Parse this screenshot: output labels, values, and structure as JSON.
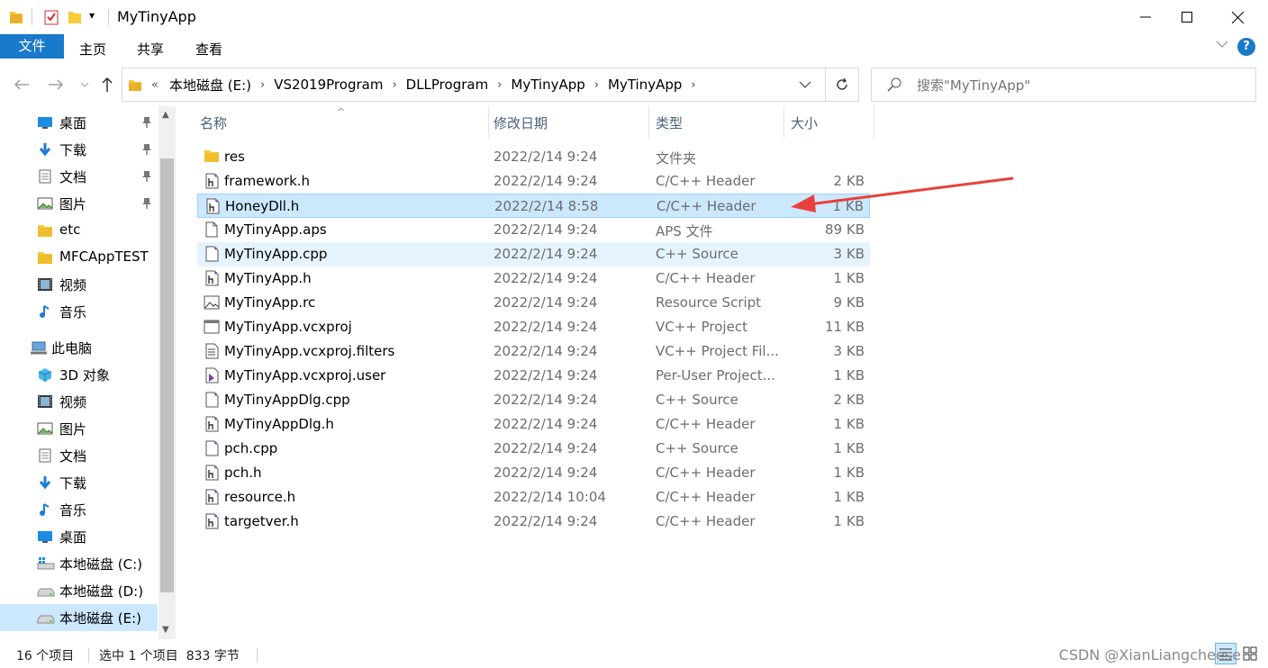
{
  "window": {
    "title": "MyTinyApp",
    "quick_access_dropdown": "▾"
  },
  "ribbon": {
    "tabs": [
      "文件",
      "主页",
      "共享",
      "查看"
    ],
    "help": "?"
  },
  "address": {
    "overflow": "«",
    "crumbs": [
      "本地磁盘 (E:)",
      "VS2019Program",
      "DLLProgram",
      "MyTinyApp",
      "MyTinyApp"
    ]
  },
  "search": {
    "placeholder": "搜索\"MyTinyApp\""
  },
  "sidebar": {
    "quick_access": [
      {
        "label": "桌面",
        "icon": "desktop-icon",
        "pinned": true
      },
      {
        "label": "下载",
        "icon": "download-icon",
        "pinned": true
      },
      {
        "label": "文档",
        "icon": "document-icon",
        "pinned": true
      },
      {
        "label": "图片",
        "icon": "picture-icon",
        "pinned": true
      },
      {
        "label": "etc",
        "icon": "folder-icon",
        "pinned": false
      },
      {
        "label": "MFCAppTEST",
        "icon": "folder-icon",
        "pinned": false
      },
      {
        "label": "视频",
        "icon": "video-icon",
        "pinned": false
      },
      {
        "label": "音乐",
        "icon": "music-icon",
        "pinned": false
      }
    ],
    "this_pc": {
      "label": "此电脑",
      "icon": "computer-icon"
    },
    "pc_items": [
      {
        "label": "3D 对象",
        "icon": "3d-objects-icon"
      },
      {
        "label": "视频",
        "icon": "video-icon"
      },
      {
        "label": "图片",
        "icon": "picture-icon"
      },
      {
        "label": "文档",
        "icon": "document-icon"
      },
      {
        "label": "下载",
        "icon": "download-icon"
      },
      {
        "label": "音乐",
        "icon": "music-icon"
      },
      {
        "label": "桌面",
        "icon": "desktop-icon"
      },
      {
        "label": "本地磁盘 (C:)",
        "icon": "system-drive-icon"
      },
      {
        "label": "本地磁盘 (D:)",
        "icon": "drive-icon"
      },
      {
        "label": "本地磁盘 (E:)",
        "icon": "drive-icon",
        "selected": true
      }
    ]
  },
  "columns": {
    "name": "名称",
    "date": "修改日期",
    "type": "类型",
    "size": "大小"
  },
  "files": [
    {
      "name": "res",
      "date": "2022/2/14 9:24",
      "type": "文件夹",
      "size": "",
      "icon": "folder-icon"
    },
    {
      "name": "framework.h",
      "date": "2022/2/14 9:24",
      "type": "C/C++ Header",
      "size": "2 KB",
      "icon": "header-file-icon"
    },
    {
      "name": "HoneyDll.h",
      "date": "2022/2/14 8:58",
      "type": "C/C++ Header",
      "size": "1 KB",
      "icon": "header-file-icon",
      "state": "selected"
    },
    {
      "name": "MyTinyApp.aps",
      "date": "2022/2/14 9:24",
      "type": "APS 文件",
      "size": "89 KB",
      "icon": "blank-file-icon"
    },
    {
      "name": "MyTinyApp.cpp",
      "date": "2022/2/14 9:24",
      "type": "C++ Source",
      "size": "3 KB",
      "icon": "cpp-file-icon",
      "state": "hover"
    },
    {
      "name": "MyTinyApp.h",
      "date": "2022/2/14 9:24",
      "type": "C/C++ Header",
      "size": "1 KB",
      "icon": "header-file-icon"
    },
    {
      "name": "MyTinyApp.rc",
      "date": "2022/2/14 9:24",
      "type": "Resource Script",
      "size": "9 KB",
      "icon": "resource-file-icon"
    },
    {
      "name": "MyTinyApp.vcxproj",
      "date": "2022/2/14 9:24",
      "type": "VC++ Project",
      "size": "11 KB",
      "icon": "project-file-icon"
    },
    {
      "name": "MyTinyApp.vcxproj.filters",
      "date": "2022/2/14 9:24",
      "type": "VC++ Project Fil...",
      "size": "3 KB",
      "icon": "filters-file-icon"
    },
    {
      "name": "MyTinyApp.vcxproj.user",
      "date": "2022/2/14 9:24",
      "type": "Per-User Project...",
      "size": "1 KB",
      "icon": "vs-user-file-icon"
    },
    {
      "name": "MyTinyAppDlg.cpp",
      "date": "2022/2/14 9:24",
      "type": "C++ Source",
      "size": "2 KB",
      "icon": "cpp-file-icon"
    },
    {
      "name": "MyTinyAppDlg.h",
      "date": "2022/2/14 9:24",
      "type": "C/C++ Header",
      "size": "1 KB",
      "icon": "header-file-icon"
    },
    {
      "name": "pch.cpp",
      "date": "2022/2/14 9:24",
      "type": "C++ Source",
      "size": "1 KB",
      "icon": "cpp-file-icon"
    },
    {
      "name": "pch.h",
      "date": "2022/2/14 9:24",
      "type": "C/C++ Header",
      "size": "1 KB",
      "icon": "header-file-icon"
    },
    {
      "name": "resource.h",
      "date": "2022/2/14 10:04",
      "type": "C/C++ Header",
      "size": "1 KB",
      "icon": "header-file-icon"
    },
    {
      "name": "targetver.h",
      "date": "2022/2/14 9:24",
      "type": "C/C++ Header",
      "size": "1 KB",
      "icon": "header-file-icon"
    }
  ],
  "status": {
    "count": "16 个项目",
    "selection": "选中 1 个项目  833 字节",
    "watermark": "CSDN @XianLiangcheese"
  },
  "colors": {
    "accent": "#1979ca",
    "selection": "#cce8ff",
    "hover": "#e5f3ff",
    "annotation_arrow": "#e8413c"
  }
}
